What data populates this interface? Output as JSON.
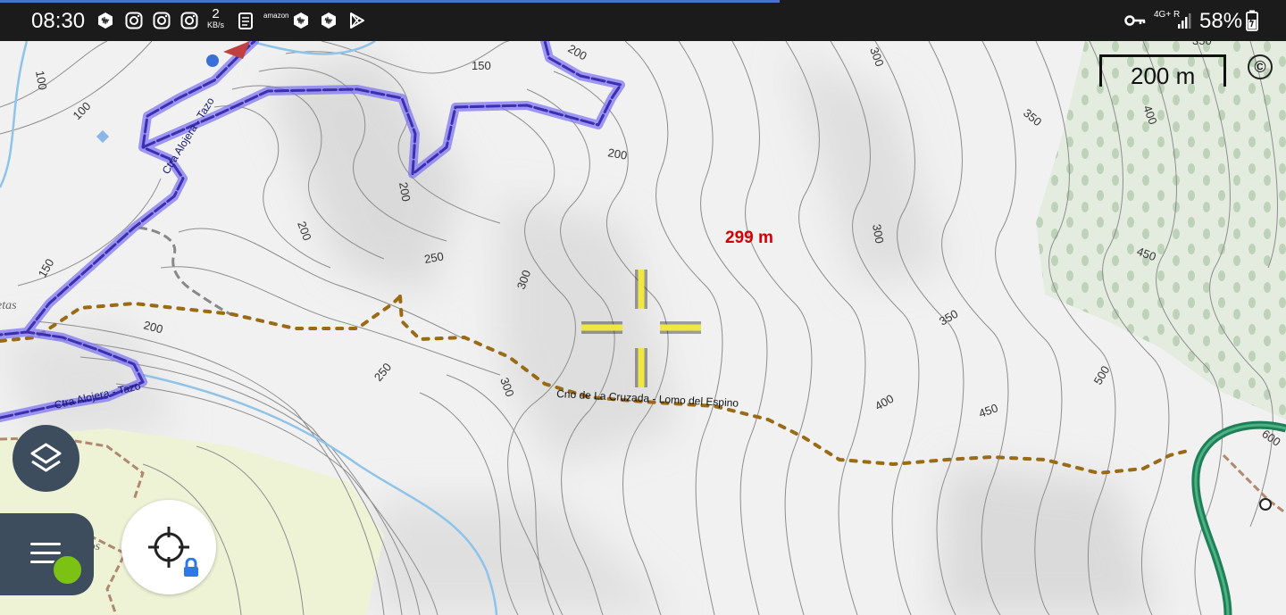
{
  "status_bar": {
    "time": "08:30",
    "net_rate_value": "2",
    "net_rate_unit": "KB/s",
    "amazon_label": "amazon",
    "network_type": "4G+",
    "roaming": "R",
    "battery": "58%",
    "icons": [
      "audiomack-icon",
      "instagram-icon",
      "instagram-icon",
      "instagram-icon",
      "clipboard-icon",
      "amazon-icon",
      "audiomack-icon",
      "audiomack-icon",
      "play-store-icon",
      "key-icon",
      "signal-icon",
      "battery-icon"
    ]
  },
  "map": {
    "scale_label": "200 m",
    "copyright_symbol": "©",
    "altitude_label": "299 m",
    "trail_label": "Cno de La Cruzada - Lomo del Espino",
    "road_labels": [
      "Ctra Alojera - Tazo",
      "Ctra Alojera - Tazo"
    ],
    "contour_labels": [
      "100",
      "100",
      "150",
      "150",
      "200",
      "200",
      "200",
      "200",
      "200",
      "250",
      "250",
      "300",
      "300",
      "300",
      "300",
      "350",
      "350",
      "350",
      "400",
      "400",
      "450",
      "450",
      "500",
      "600"
    ],
    "place_labels": [
      "Llanos",
      "etas"
    ],
    "colors": {
      "road": "#5b49e0",
      "trail": "#9a6a14",
      "contour": "#8a8a8a",
      "water": "#8ec3ea",
      "forest": "#dfe9da",
      "meadow": "#eef4d8",
      "green_road": "#1f7f5a",
      "crosshair": "#f0e840",
      "altitude": "#d40000"
    }
  },
  "controls": {
    "layers_button_icon": "layers-icon",
    "menu_button_icon": "menu-icon",
    "locate_button_icon": "crosshair-gps-icon",
    "lock_icon": "lock-icon"
  }
}
